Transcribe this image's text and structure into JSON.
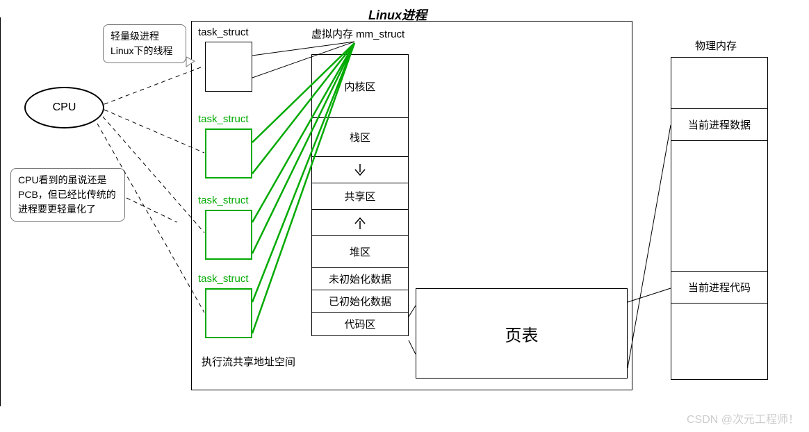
{
  "title": "Linux进程",
  "callouts": {
    "lwp": "轻量级进程\nLinux下的线程",
    "pcb": "CPU看到的虽说还是PCB，但已经比传统的进程要更轻量化了"
  },
  "cpu_label": "CPU",
  "task_struct_main": "task_struct",
  "task_struct_green": "task_struct",
  "mm_struct_label": "虚拟内存 mm_struct",
  "vm_regions": {
    "kernel": "内核区",
    "stack": "栈区",
    "shared": "共享区",
    "heap": "堆区",
    "bss": "未初始化数据",
    "data": "已初始化数据",
    "text": "代码区"
  },
  "shared_as_note": "执行流共享地址空间",
  "page_table": "页表",
  "phys_mem_title": "物理内存",
  "phys_mem": {
    "data": "当前进程数据",
    "code": "当前进程代码"
  },
  "watermark": "CSDN @次元工程师！"
}
